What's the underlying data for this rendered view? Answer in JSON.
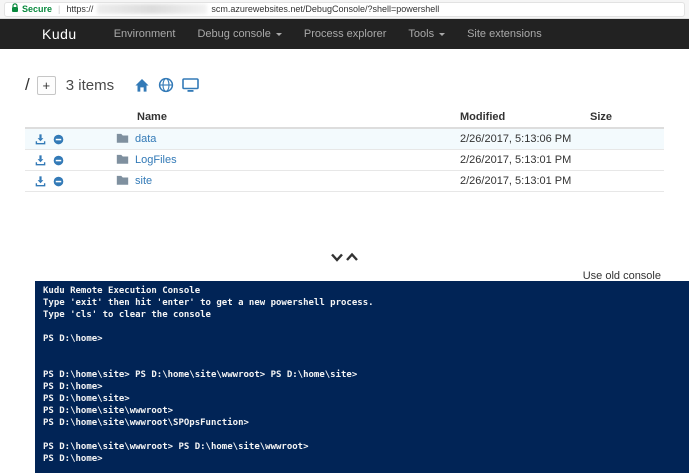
{
  "colors": {
    "accent": "#337ab7",
    "console-bg": "#012456",
    "secure-green": "#0a8a3e",
    "navbar-bg": "#222222"
  },
  "browser": {
    "secure_label": "Secure",
    "url_prefix": "https://",
    "url_suffix": "scm.azurewebsites.net/DebugConsole/?shell=powershell"
  },
  "navbar": {
    "brand": "Kudu",
    "items": [
      {
        "label": "Environment",
        "has_dropdown": false
      },
      {
        "label": "Debug console",
        "has_dropdown": true
      },
      {
        "label": "Process explorer",
        "has_dropdown": false
      },
      {
        "label": "Tools",
        "has_dropdown": true
      },
      {
        "label": "Site extensions",
        "has_dropdown": false
      }
    ]
  },
  "breadcrumb": {
    "path": "/",
    "add_label": "+",
    "items_count": "3 items"
  },
  "file_table": {
    "headers": [
      "Name",
      "Modified",
      "Size"
    ],
    "rows": [
      {
        "name": "data",
        "modified": "2/26/2017, 5:13:06 PM",
        "size": ""
      },
      {
        "name": "LogFiles",
        "modified": "2/26/2017, 5:13:01 PM",
        "size": ""
      },
      {
        "name": "site",
        "modified": "2/26/2017, 5:13:01 PM",
        "size": ""
      }
    ]
  },
  "console": {
    "use_old_console_label": "Use old console",
    "lines": [
      "Kudu Remote Execution Console",
      "Type 'exit' then hit 'enter' to get a new powershell process.",
      "Type 'cls' to clear the console",
      "",
      "PS D:\\home>",
      "",
      "",
      "PS D:\\home\\site> PS D:\\home\\site\\wwwroot> PS D:\\home\\site>",
      "PS D:\\home>",
      "PS D:\\home\\site>",
      "PS D:\\home\\site\\wwwroot>",
      "PS D:\\home\\site\\wwwroot\\SPOpsFunction>",
      "",
      "PS D:\\home\\site\\wwwroot> PS D:\\home\\site\\wwwroot>",
      "PS D:\\home>"
    ]
  }
}
